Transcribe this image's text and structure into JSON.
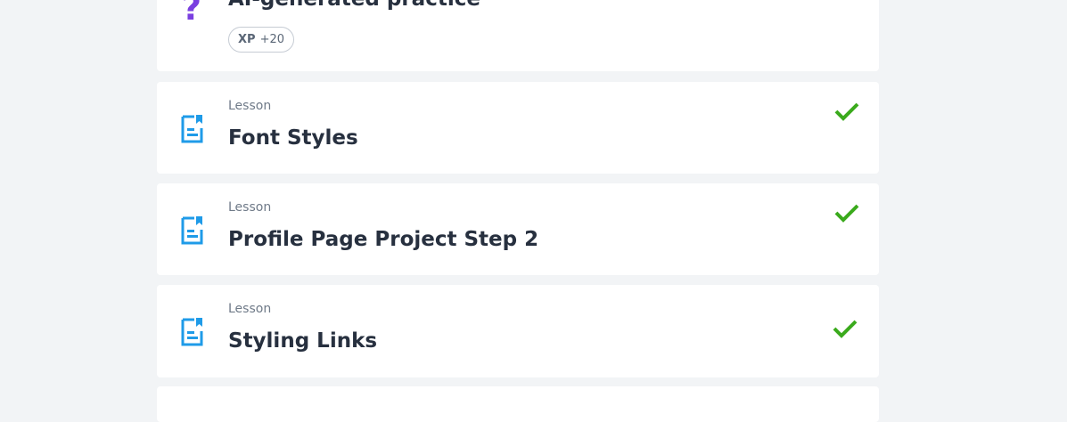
{
  "practice": {
    "icon": "question-icon",
    "icon_glyph": "?",
    "title": "AI-generated practice",
    "xp_label": "XP",
    "xp_value": "+20",
    "accent_color": "#7a3fe0"
  },
  "lessons": [
    {
      "kicker": "Lesson",
      "title": "Font Styles",
      "icon": "lesson-document-icon",
      "status": "completed",
      "status_icon": "check-icon"
    },
    {
      "kicker": "Lesson",
      "title": "Profile Page Project Step 2",
      "icon": "lesson-document-icon",
      "status": "completed",
      "status_icon": "check-icon"
    },
    {
      "kicker": "Lesson",
      "title": "Styling Links",
      "icon": "lesson-document-icon",
      "status": "completed",
      "status_icon": "check-icon"
    }
  ],
  "colors": {
    "background": "#f2f4f6",
    "card": "#ffffff",
    "lesson_icon": "#1f9be8",
    "check": "#3aaa1c",
    "title_text": "#27303f"
  }
}
